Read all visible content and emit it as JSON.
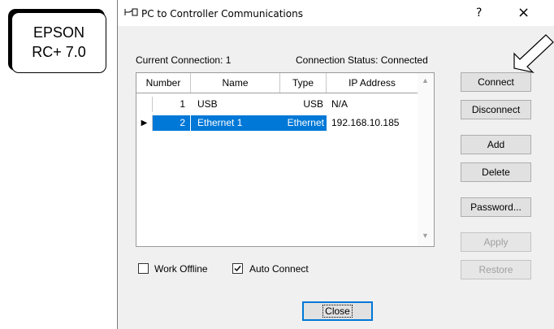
{
  "badge": {
    "line1": "EPSON",
    "line2": "RC+ 7.0"
  },
  "window": {
    "title": "PC to Controller Communications",
    "help": "?",
    "close": "×"
  },
  "status": {
    "current_connection": "Current Connection: 1",
    "connection_status": "Connection Status: Connected"
  },
  "grid": {
    "columns": [
      "Number",
      "Name",
      "Type",
      "IP Address"
    ],
    "rows": [
      {
        "number": "1",
        "name": "USB",
        "type": "USB",
        "ip": "N/A",
        "selected": false
      },
      {
        "number": "2",
        "name": "Ethernet 1",
        "type": "Ethernet",
        "ip": "192.168.10.185",
        "selected": true
      }
    ]
  },
  "buttons": {
    "connect": "Connect",
    "disconnect": "Disconnect",
    "add": "Add",
    "delete": "Delete",
    "password": "Password...",
    "apply": "Apply",
    "restore": "Restore",
    "close": "Close"
  },
  "options": {
    "work_offline": {
      "label": "Work Offline",
      "checked": false
    },
    "auto_connect": {
      "label": "Auto Connect",
      "checked": true
    }
  }
}
